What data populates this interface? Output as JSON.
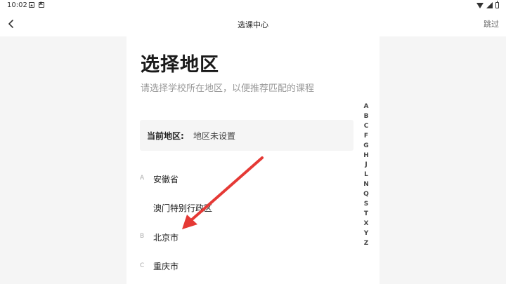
{
  "status_bar": {
    "time": "10:02"
  },
  "header": {
    "title": "选课中心",
    "skip_label": "跳过"
  },
  "page": {
    "title": "选择地区",
    "subtitle": "请选择学校所在地区，以便推荐匹配的课程"
  },
  "current_region": {
    "label": "当前地区:",
    "value": "地区未设置"
  },
  "region_list": [
    {
      "letter": "A",
      "name": "安徽省"
    },
    {
      "letter": "",
      "name": "澳门特别行政区"
    },
    {
      "letter": "B",
      "name": "北京市"
    },
    {
      "letter": "C",
      "name": "重庆市"
    }
  ],
  "alpha_index": [
    "A",
    "B",
    "C",
    "F",
    "G",
    "H",
    "J",
    "L",
    "N",
    "Q",
    "S",
    "T",
    "X",
    "Y",
    "Z"
  ],
  "colors": {
    "arrow": "#e53935",
    "background": "#f5f5f5",
    "panel": "#ffffff"
  },
  "icons": {
    "back": "back-arrow-icon",
    "wifi": "wifi-icon",
    "signal": "signal-icon",
    "battery": "battery-icon"
  }
}
